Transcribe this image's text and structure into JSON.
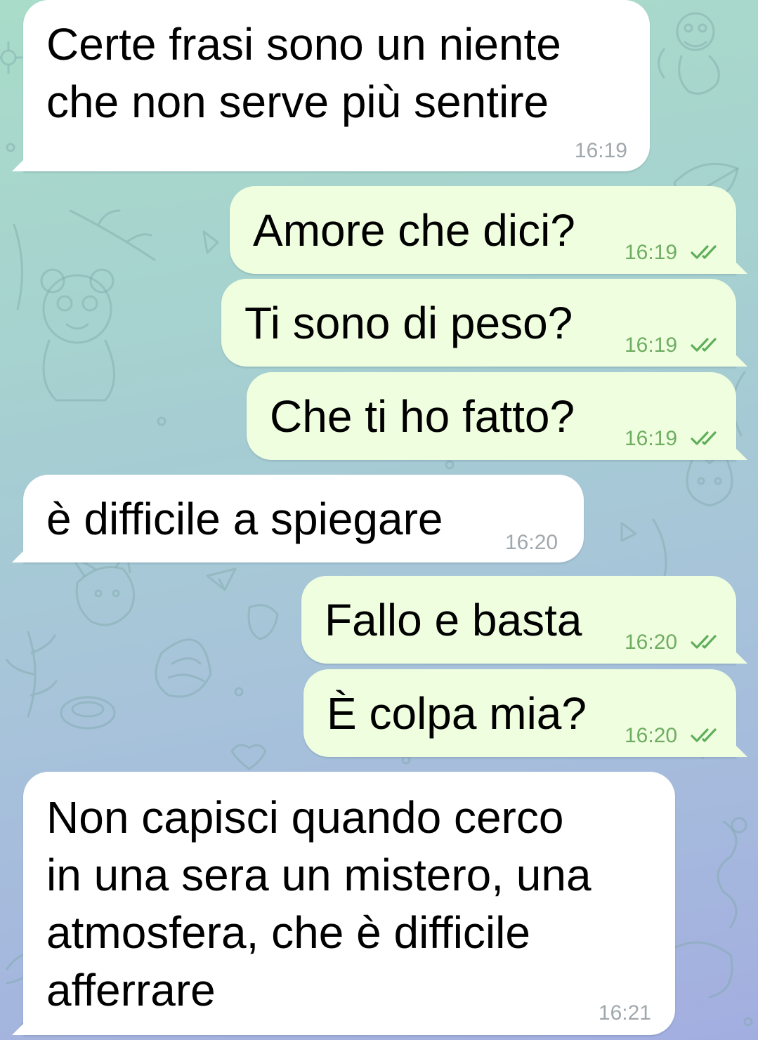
{
  "messages": [
    {
      "direction": "incoming",
      "text": "Certe frasi sono un niente\nche non serve più sentire",
      "time": "16:19"
    },
    {
      "direction": "outgoing",
      "text": "Amore che dici?",
      "time": "16:19",
      "status": "read-double-check-icon"
    },
    {
      "direction": "outgoing",
      "text": "Ti sono di peso?",
      "time": "16:19",
      "status": "read-double-check-icon"
    },
    {
      "direction": "outgoing",
      "text": "Che ti ho fatto?",
      "time": "16:19",
      "status": "read-double-check-icon"
    },
    {
      "direction": "incoming",
      "text": "è difficile a spiegare",
      "time": "16:20"
    },
    {
      "direction": "outgoing",
      "text": "Fallo e basta",
      "time": "16:20",
      "status": "read-double-check-icon"
    },
    {
      "direction": "outgoing",
      "text": "È colpa mia?",
      "time": "16:20",
      "status": "read-double-check-icon"
    },
    {
      "direction": "incoming",
      "text": "Non capisci quando cerco\nin una sera un mistero, una\natmosfera, che è difficile\nafferrare",
      "time": "16:21"
    }
  ],
  "colors": {
    "incoming_bubble": "#ffffff",
    "outgoing_bubble": "#effedf",
    "outgoing_time": "#6fad62",
    "read_ticks": "#5fae5a",
    "incoming_time": "#a0a8ad",
    "wallpaper_top": "#a9dcc9",
    "wallpaper_bottom": "#a3aee0"
  }
}
